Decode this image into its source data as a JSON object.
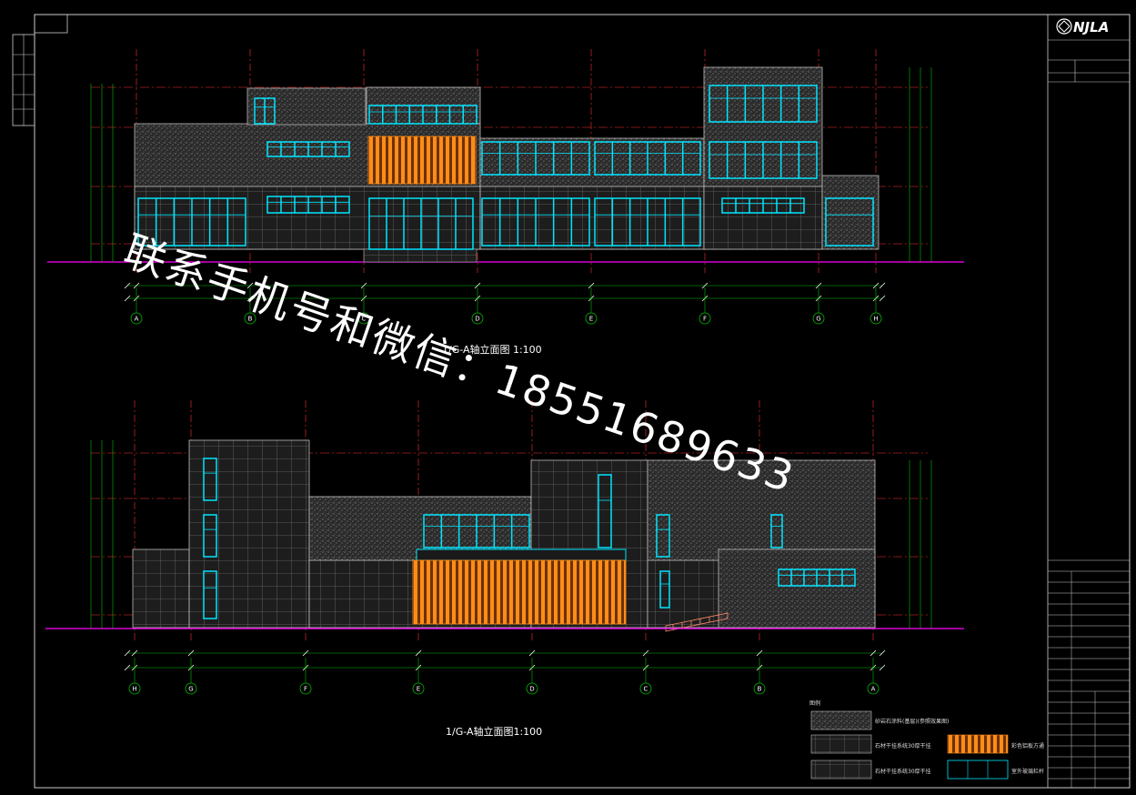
{
  "title_block": {
    "logo": "NJLA",
    "legend_title": "图例"
  },
  "drawing1": {
    "caption": "1/G-A轴立面图 1:100",
    "axes": [
      "A",
      "B",
      "C",
      "D",
      "E",
      "F",
      "G",
      "H"
    ]
  },
  "drawing2": {
    "caption": "1/G-A轴立面图1:100",
    "axes": [
      "H",
      "G",
      "F",
      "E",
      "D",
      "C",
      "B",
      "A"
    ]
  },
  "legend": {
    "title": "图例",
    "items": [
      {
        "label": "砂岩石涂料(基层)(参照效果图)"
      },
      {
        "label": "石材干挂系统30厚干挂"
      },
      {
        "label": "彩色铝板方通"
      },
      {
        "label": "石材干挂系统30厚干挂"
      },
      {
        "label": "室外玻璃栏杆"
      }
    ]
  },
  "watermark": {
    "text": "联系手机号和微信：18551689633"
  },
  "colors": {
    "background": "#000000",
    "window": "#00e5ff",
    "grid_axis": "#00c000",
    "red_axis": "#ff3030",
    "ground": "#ff00ff",
    "orange": "#ff8c1a",
    "wall": "#555555"
  }
}
